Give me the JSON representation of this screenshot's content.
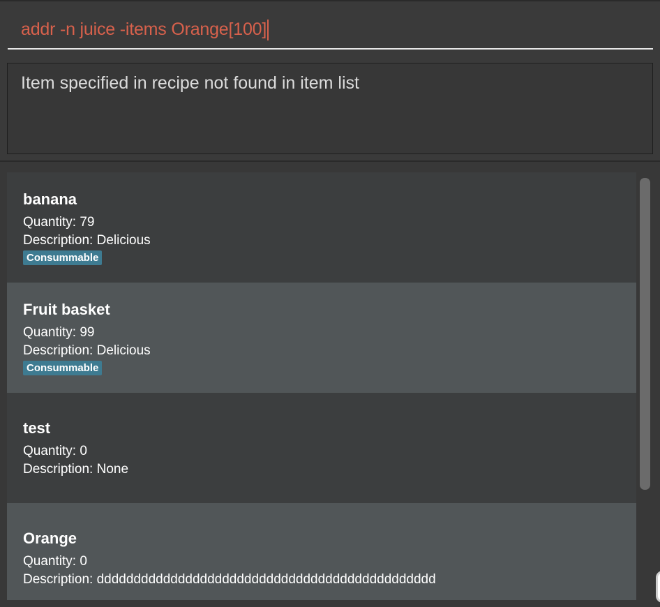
{
  "command_box": {
    "value": "addr -n juice -items Orange[100]",
    "text_color": "#d8614c"
  },
  "result_display": {
    "message": "Item specified in recipe not found in item list"
  },
  "item_list": {
    "items": [
      {
        "name": "banana",
        "quantity": "Quantity: 79",
        "description": "Description: Delicious",
        "tag": "Consummable"
      },
      {
        "name": "Fruit basket",
        "quantity": "Quantity: 99",
        "description": "Description: Delicious",
        "tag": "Consummable"
      },
      {
        "name": "test",
        "quantity": "Quantity: 0",
        "description": "Description: None"
      },
      {
        "name": "Orange",
        "quantity": "Quantity: 0",
        "description": "Description: dddddddddddddddddddddddddddddddddddddddddddddd"
      }
    ],
    "tag_color": "#3e7b91"
  },
  "scrollbar": {
    "visible_fraction": 0.73
  }
}
